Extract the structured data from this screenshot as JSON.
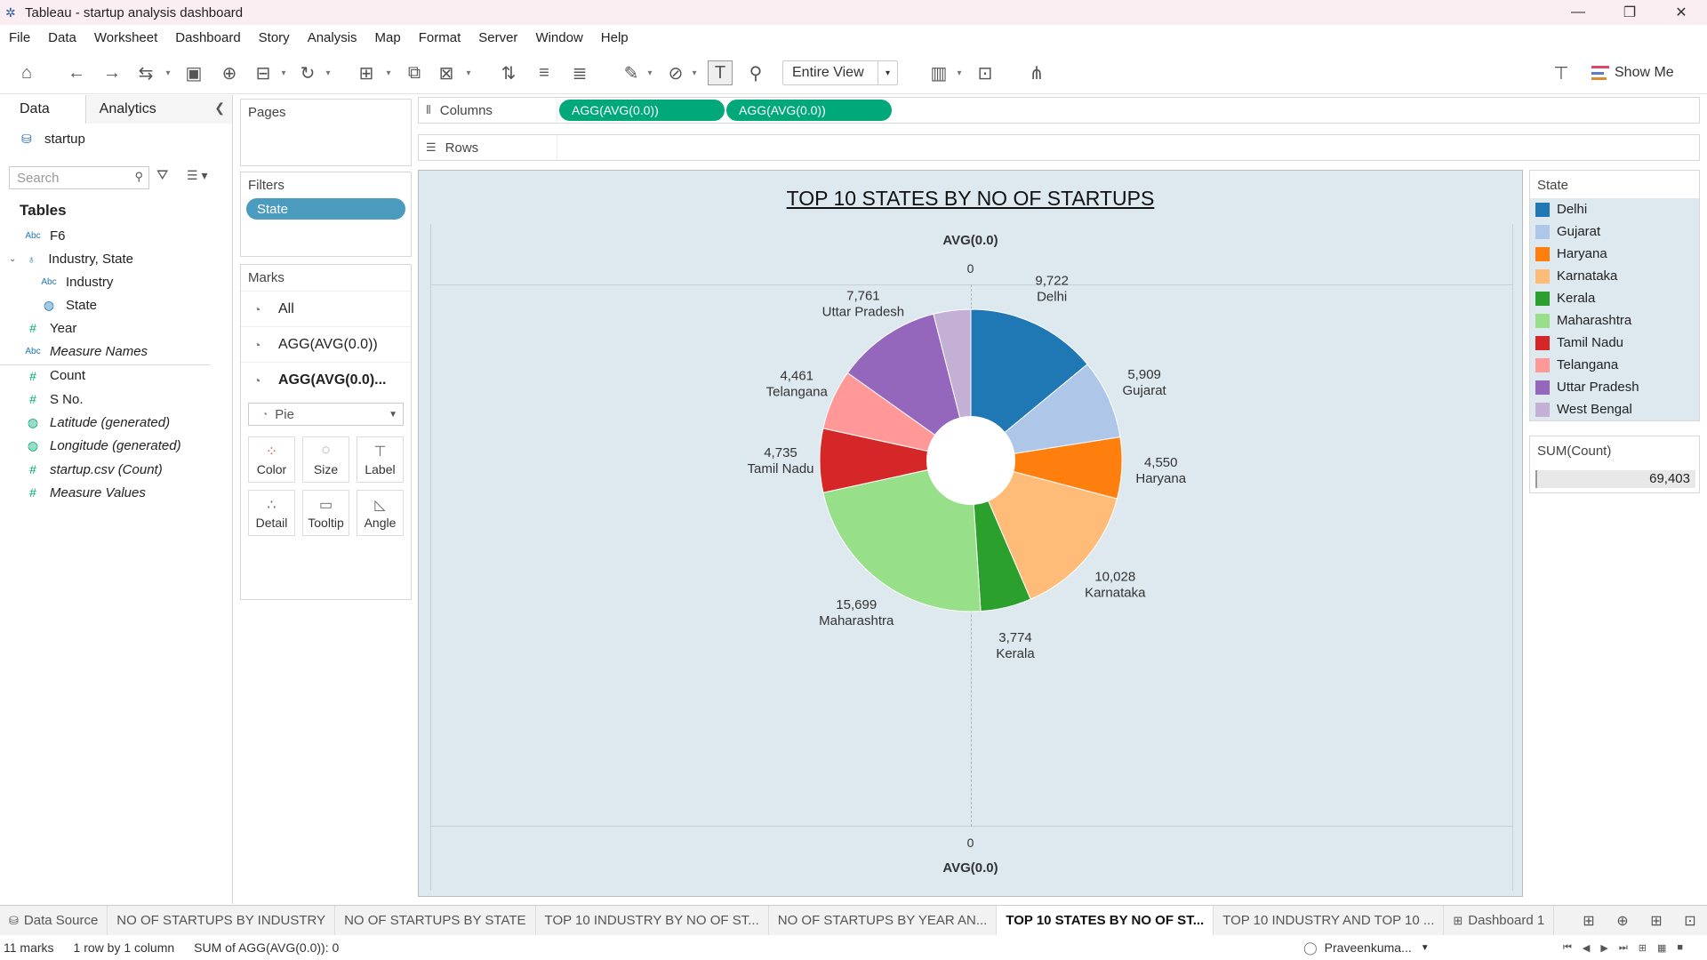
{
  "window": {
    "title": "Tableau - startup analysis dashboard",
    "controls": [
      "—",
      "❐",
      "✕"
    ]
  },
  "menu": [
    "File",
    "Data",
    "Worksheet",
    "Dashboard",
    "Story",
    "Analysis",
    "Map",
    "Format",
    "Server",
    "Window",
    "Help"
  ],
  "toolbar": {
    "fit_select": "Entire View",
    "show_me": "Show Me"
  },
  "data_pane": {
    "tabs": [
      "Data",
      "Analytics"
    ],
    "source": "startup",
    "search_placeholder": "Search",
    "tables_heading": "Tables",
    "fields": [
      {
        "type": "Abc",
        "name": "F6"
      },
      {
        "type": "hier",
        "name": "Industry, State"
      },
      {
        "type": "Abc",
        "name": "Industry"
      },
      {
        "type": "geo",
        "name": "State"
      },
      {
        "type": "#",
        "name": "Year"
      },
      {
        "type": "Abc",
        "name": "Measure Names"
      },
      {
        "type": "#",
        "name": "Count"
      },
      {
        "type": "#",
        "name": "S No."
      },
      {
        "type": "geo",
        "name": "Latitude (generated)"
      },
      {
        "type": "geo",
        "name": "Longitude (generated)"
      },
      {
        "type": "#",
        "name": "startup.csv (Count)"
      },
      {
        "type": "#",
        "name": "Measure Values"
      }
    ]
  },
  "pages": {
    "title": "Pages"
  },
  "filters": {
    "title": "Filters",
    "pill": "State"
  },
  "marks": {
    "title": "Marks",
    "rows": [
      "All",
      "AGG(AVG(0.0))",
      "AGG(AVG(0.0)..."
    ],
    "type": "Pie",
    "buttons": [
      "Color",
      "Size",
      "Label",
      "Detail",
      "Tooltip",
      "Angle"
    ]
  },
  "shelves": {
    "columns_label": "Columns",
    "rows_label": "Rows",
    "column_pills": [
      "AGG(AVG(0.0))",
      "AGG(AVG(0.0))"
    ]
  },
  "view": {
    "title": "TOP 10 STATES BY NO OF STARTUPS",
    "axis_top": "AVG(0.0)",
    "axis_top_zero": "0",
    "axis_bottom_zero": "0",
    "axis_bottom": "AVG(0.0)"
  },
  "chart_data": {
    "type": "pie",
    "title": "TOP 10 STATES BY NO OF STARTUPS",
    "donut": true,
    "slices": [
      {
        "label": "Delhi",
        "value": 9722,
        "display": "9,722",
        "color": "#1f77b4"
      },
      {
        "label": "Gujarat",
        "value": 5909,
        "display": "5,909",
        "color": "#aec7e8"
      },
      {
        "label": "Haryana",
        "value": 4550,
        "display": "4,550",
        "color": "#ff7f0e"
      },
      {
        "label": "Karnataka",
        "value": 10028,
        "display": "10,028",
        "color": "#ffbb78"
      },
      {
        "label": "Kerala",
        "value": 3774,
        "display": "3,774",
        "color": "#2ca02c"
      },
      {
        "label": "Maharashtra",
        "value": 15699,
        "display": "15,699",
        "color": "#98df8a"
      },
      {
        "label": "Tamil Nadu",
        "value": 4735,
        "display": "4,735",
        "color": "#d62728"
      },
      {
        "label": "Telangana",
        "value": 4461,
        "display": "4,461",
        "color": "#ff9896"
      },
      {
        "label": "Uttar Pradesh",
        "value": 7761,
        "display": "7,761",
        "color": "#9467bd"
      },
      {
        "label": "West Bengal",
        "value": 2764,
        "display": "",
        "color": "#c5b0d5"
      }
    ]
  },
  "legend": {
    "title": "State",
    "items": [
      {
        "label": "Delhi",
        "color": "#1f77b4"
      },
      {
        "label": "Gujarat",
        "color": "#aec7e8"
      },
      {
        "label": "Haryana",
        "color": "#ff7f0e"
      },
      {
        "label": "Karnataka",
        "color": "#ffbb78"
      },
      {
        "label": "Kerala",
        "color": "#2ca02c"
      },
      {
        "label": "Maharashtra",
        "color": "#98df8a"
      },
      {
        "label": "Tamil Nadu",
        "color": "#d62728"
      },
      {
        "label": "Telangana",
        "color": "#ff9896"
      },
      {
        "label": "Uttar Pradesh",
        "color": "#9467bd"
      },
      {
        "label": "West Bengal",
        "color": "#c5b0d5"
      }
    ]
  },
  "sum_card": {
    "title": "SUM(Count)",
    "value": "69,403"
  },
  "sheet_tabs": {
    "data_source": "Data Source",
    "tabs": [
      "NO OF STARTUPS BY INDUSTRY",
      "NO OF STARTUPS BY STATE",
      "TOP 10 INDUSTRY BY NO OF ST...",
      "NO OF STARTUPS BY YEAR AN...",
      "TOP 10 STATES BY NO OF ST...",
      "TOP 10 INDUSTRY AND TOP 10 ...",
      "Dashboard 1"
    ],
    "active_index": 4
  },
  "status": {
    "marks": "11 marks",
    "dims": "1 row by 1 column",
    "sum": "SUM of AGG(AVG(0.0)): 0",
    "user": "Praveenkuma..."
  }
}
